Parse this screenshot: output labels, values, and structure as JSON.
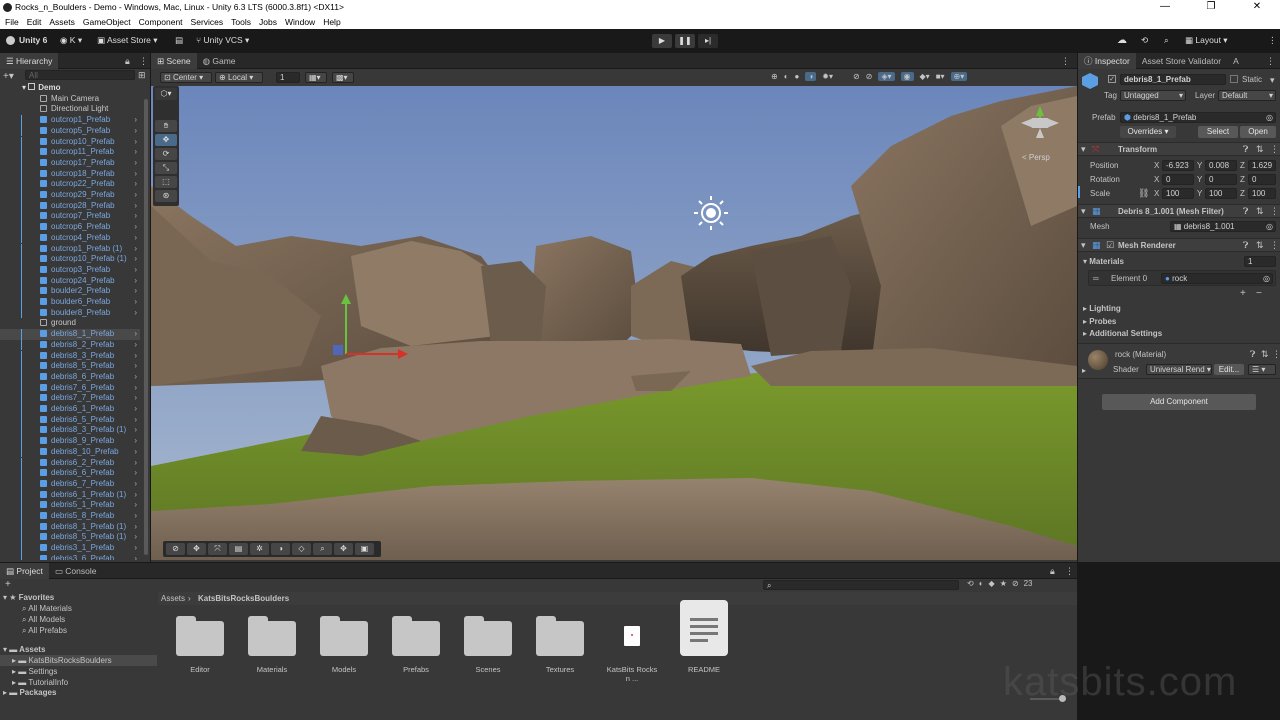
{
  "window": {
    "title": "Rocks_n_Boulders - Demo - Windows, Mac, Linux - Unity 6.3 LTS (6000.3.8f1) <DX11>",
    "min": "—",
    "max": "❐",
    "close": "✕"
  },
  "menu": [
    "File",
    "Edit",
    "Assets",
    "GameObject",
    "Component",
    "Services",
    "Tools",
    "Jobs",
    "Window",
    "Help"
  ],
  "toolbar": {
    "unity": "Unity 6",
    "account": "K",
    "asset_store": "Asset Store",
    "vcs": "Unity VCS",
    "layout": "Layout"
  },
  "hierarchy": {
    "tab": "Hierarchy",
    "search_placeholder": "All",
    "scene": "Demo",
    "items": [
      {
        "name": "Main Camera",
        "type": "obj"
      },
      {
        "name": "Directional Light",
        "type": "obj"
      },
      {
        "name": "outcrop1_Prefab",
        "type": "prefab"
      },
      {
        "name": "outcrop5_Prefab",
        "type": "prefab"
      },
      {
        "name": "outcrop10_Prefab",
        "type": "prefab"
      },
      {
        "name": "outcrop11_Prefab",
        "type": "prefab"
      },
      {
        "name": "outcrop17_Prefab",
        "type": "prefab"
      },
      {
        "name": "outcrop18_Prefab",
        "type": "prefab"
      },
      {
        "name": "outcrop22_Prefab",
        "type": "prefab"
      },
      {
        "name": "outcrop29_Prefab",
        "type": "prefab"
      },
      {
        "name": "outcrop28_Prefab",
        "type": "prefab"
      },
      {
        "name": "outcrop7_Prefab",
        "type": "prefab"
      },
      {
        "name": "outcrop6_Prefab",
        "type": "prefab"
      },
      {
        "name": "outcrop4_Prefab",
        "type": "prefab"
      },
      {
        "name": "outcrop1_Prefab (1)",
        "type": "prefab"
      },
      {
        "name": "outcrop10_Prefab (1)",
        "type": "prefab"
      },
      {
        "name": "outcrop3_Prefab",
        "type": "prefab"
      },
      {
        "name": "outcrop24_Prefab",
        "type": "prefab"
      },
      {
        "name": "boulder2_Prefab",
        "type": "prefab"
      },
      {
        "name": "boulder6_Prefab",
        "type": "prefab"
      },
      {
        "name": "boulder8_Prefab",
        "type": "prefab"
      },
      {
        "name": "ground",
        "type": "obj"
      },
      {
        "name": "debris8_1_Prefab",
        "type": "prefab",
        "selected": true
      },
      {
        "name": "debris8_2_Prefab",
        "type": "prefab"
      },
      {
        "name": "debris8_3_Prefab",
        "type": "prefab"
      },
      {
        "name": "debris8_5_Prefab",
        "type": "prefab"
      },
      {
        "name": "debris8_6_Prefab",
        "type": "prefab"
      },
      {
        "name": "debris7_6_Prefab",
        "type": "prefab"
      },
      {
        "name": "debris7_7_Prefab",
        "type": "prefab"
      },
      {
        "name": "debris6_1_Prefab",
        "type": "prefab"
      },
      {
        "name": "debris6_5_Prefab",
        "type": "prefab"
      },
      {
        "name": "debris8_3_Prefab (1)",
        "type": "prefab"
      },
      {
        "name": "debris8_9_Prefab",
        "type": "prefab"
      },
      {
        "name": "debris8_10_Prefab",
        "type": "prefab"
      },
      {
        "name": "debris6_2_Prefab",
        "type": "prefab"
      },
      {
        "name": "debris6_6_Prefab",
        "type": "prefab"
      },
      {
        "name": "debris6_7_Prefab",
        "type": "prefab"
      },
      {
        "name": "debris6_1_Prefab (1)",
        "type": "prefab"
      },
      {
        "name": "debris5_1_Prefab",
        "type": "prefab"
      },
      {
        "name": "debris5_8_Prefab",
        "type": "prefab"
      },
      {
        "name": "debris8_1_Prefab (1)",
        "type": "prefab"
      },
      {
        "name": "debris8_5_Prefab (1)",
        "type": "prefab"
      },
      {
        "name": "debris3_1_Prefab",
        "type": "prefab"
      },
      {
        "name": "debris3_6_Prefab",
        "type": "prefab"
      }
    ]
  },
  "scene_view": {
    "tabs": [
      "Scene",
      "Game"
    ],
    "pivot": "Center",
    "space": "Local",
    "snap": "1",
    "persp": "< Persp"
  },
  "inspector": {
    "tabs": [
      "Inspector",
      "Asset Store Validator",
      "A"
    ],
    "object_name": "debris8_1_Prefab",
    "static": "Static",
    "tag_label": "Tag",
    "tag": "Untagged",
    "layer_label": "Layer",
    "layer": "Default",
    "prefab_label": "Prefab",
    "prefab": "debris8_1_Prefab",
    "overrides": "Overrides",
    "select": "Select",
    "open": "Open",
    "transform": {
      "title": "Transform",
      "position": {
        "label": "Position",
        "x": "-6.923",
        "y": "0.008",
        "z": "1.629"
      },
      "rotation": {
        "label": "Rotation",
        "x": "0",
        "y": "0",
        "z": "0"
      },
      "scale": {
        "label": "Scale",
        "x": "100",
        "y": "100",
        "z": "100"
      }
    },
    "mesh_filter": {
      "title": "Debris 8_1.001 (Mesh Filter)",
      "mesh_label": "Mesh",
      "mesh": "debris8_1.001"
    },
    "mesh_renderer": {
      "title": "Mesh Renderer",
      "materials": "Materials",
      "count": "1",
      "element": "Element 0",
      "material": "rock"
    },
    "lighting": "Lighting",
    "probes": "Probes",
    "additional": "Additional Settings",
    "material": {
      "name": "rock (Material)",
      "shader_label": "Shader",
      "shader": "Universal Rend",
      "edit": "Edit..."
    },
    "add_component": "Add Component"
  },
  "project": {
    "tabs": [
      "Project",
      "Console"
    ],
    "favorites": "Favorites",
    "fav_items": [
      "All Materials",
      "All Models",
      "All Prefabs"
    ],
    "assets": "Assets",
    "asset_tree": [
      "KatsBitsRocksBoulders",
      "Settings",
      "TutorialInfo"
    ],
    "packages": "Packages",
    "breadcrumb": [
      "Assets",
      "KatsBitsRocksBoulders"
    ],
    "hidden_count": "23",
    "items": [
      {
        "name": "Editor",
        "kind": "folder"
      },
      {
        "name": "Materials",
        "kind": "folder"
      },
      {
        "name": "Models",
        "kind": "folder"
      },
      {
        "name": "Prefabs",
        "kind": "folder"
      },
      {
        "name": "Scenes",
        "kind": "folder"
      },
      {
        "name": "Textures",
        "kind": "folder"
      },
      {
        "name": "KatsBits Rocks n ...",
        "kind": "pdf"
      },
      {
        "name": "README",
        "kind": "doc"
      }
    ]
  },
  "watermark": "katsbits.com",
  "colors": {
    "selection": "#5b9ee4",
    "accent_blue": "#7ba8e0",
    "sky": "#6f88b8",
    "grass": "#6e8a2a"
  }
}
